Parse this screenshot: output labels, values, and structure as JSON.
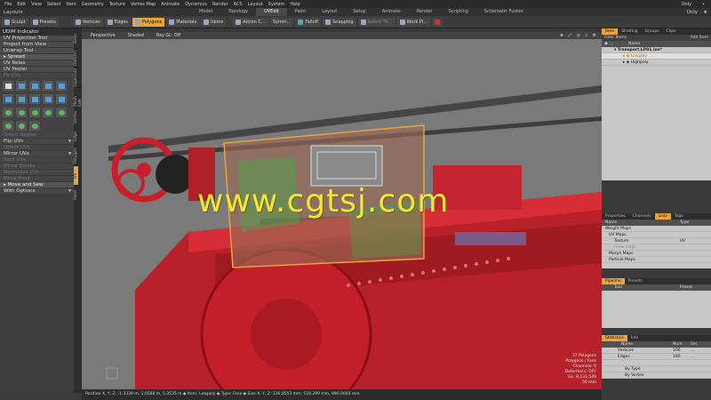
{
  "menubar": {
    "items": [
      "File",
      "Edit",
      "View",
      "Select",
      "Item",
      "Geometry",
      "Texture",
      "Vertex Map",
      "Animate",
      "Dynamics",
      "Render",
      "ACS",
      "Layout",
      "System",
      "Help"
    ],
    "right": [
      "Only",
      "•"
    ]
  },
  "tabbar": {
    "layouts_label": "Layouts",
    "tabs": [
      "Model",
      "Topology",
      "UVEdit",
      "Paint",
      "Layout",
      "Setup",
      "Animate",
      "Render",
      "Scripting",
      "Schematic Fusion"
    ],
    "active_tab": "UVEdit"
  },
  "toolbar": {
    "sculpt": "Sculpt",
    "presets": "Presets",
    "vertices": "Vertices",
    "edges": "Edges",
    "polygons": "Polygons",
    "materials": "Materials",
    "items": "Items",
    "action_center": "Action C...",
    "symmetry": "Symm...",
    "falloff": "Falloff",
    "snapping": "Snapping",
    "select_through": "Select Th...",
    "work_plane": "Work Pl..."
  },
  "leftpanel": {
    "header": "UDIM Indicator",
    "items": [
      "UV Projection Tool",
      "Project from View",
      "Unwrap Tool"
    ],
    "spread": "Spread",
    "items2": [
      "UV Relax",
      "UV Peeler",
      "Fit UVs"
    ],
    "items3": [
      "Select Region",
      "Flip UVs",
      "Orient UVs",
      "Mirror UVs",
      "Pack UVs",
      "Mirror Blocks",
      "Normalize UVs",
      "Move Pivot",
      "Move and Sew",
      "With Options"
    ],
    "dim_items": [
      "Fit UVs",
      "Select Region",
      "Orient UVs",
      "Pack UVs",
      "Mirror Blocks",
      "Normalize UVs",
      "Move Pivot"
    ]
  },
  "vtabs": [
    "Basic",
    "Deform",
    "Duplicate",
    "Mesh Edit",
    "Vertex",
    "Edge",
    "Polygon",
    "UV",
    "Paint"
  ],
  "viewport": {
    "projection": "Perspective",
    "shading": "Shaded",
    "render": "Ray GL: Off",
    "watermark": "www.cgtsj.com",
    "info": [
      "37 Polygons",
      "Polygons / Face",
      "Channels: 0",
      "Deformers: OFF",
      "GL: 8,131,549",
      "50 mm"
    ]
  },
  "statusbar": {
    "text": "Position X, Y, Z:  -1.3339 m, 1.0588 m, 5.3535 m  ◆ Item: Lowpoly ◆ Type: Face ◆ Size X, Y, Z:  336.8553 mm, 518.299 mm, 990.0003 mm"
  },
  "rightpanel": {
    "tabs": [
      "Item",
      "Shading",
      "Groups",
      "Clips"
    ],
    "filter_label": "Filter Items",
    "add_item": "Add Item",
    "col_name": "Name",
    "tree": [
      {
        "label": "Transport.LP01.lxo*",
        "indent": 14,
        "bold": true
      },
      {
        "label": "Lowpoly",
        "indent": 24,
        "bold": false,
        "color": "#e07b00"
      },
      {
        "label": "Highpoly",
        "indent": 24,
        "bold": false
      }
    ],
    "props_tabs": [
      "Properties",
      "Channels",
      "Lists",
      "Tags"
    ],
    "lists_cols": [
      "Name",
      "Type"
    ],
    "lists": [
      {
        "name": "Weight Maps",
        "type": ""
      },
      {
        "name": "UV Maps",
        "type": ""
      },
      {
        "name": "Texture",
        "type": "UV"
      },
      {
        "name": "(new map)",
        "type": ""
      },
      {
        "name": "Morph Maps",
        "type": ""
      },
      {
        "name": "Particle Maps",
        "type": ""
      }
    ],
    "pipeline_tabs": [
      "Pipeline",
      "Presets"
    ],
    "pipeline_cols": [
      "Tool",
      "Preset"
    ],
    "stats_tabs": [
      "Statistics",
      "Info"
    ],
    "stats_cols": [
      "Name",
      "Num",
      "Sel"
    ],
    "stats": [
      {
        "name": "Vertices",
        "num": "106",
        "sel": "..."
      },
      {
        "name": "Edges",
        "num": "180",
        "sel": "..."
      },
      {
        "name": "",
        "num": "",
        "sel": ""
      },
      {
        "name": "By Type",
        "num": "",
        "sel": ""
      },
      {
        "name": "By Vertex",
        "num": "",
        "sel": ""
      }
    ]
  },
  "colors": {
    "accent": "#e8a33c",
    "train_red": "#c8202a",
    "watermark": "#f2e63a"
  }
}
